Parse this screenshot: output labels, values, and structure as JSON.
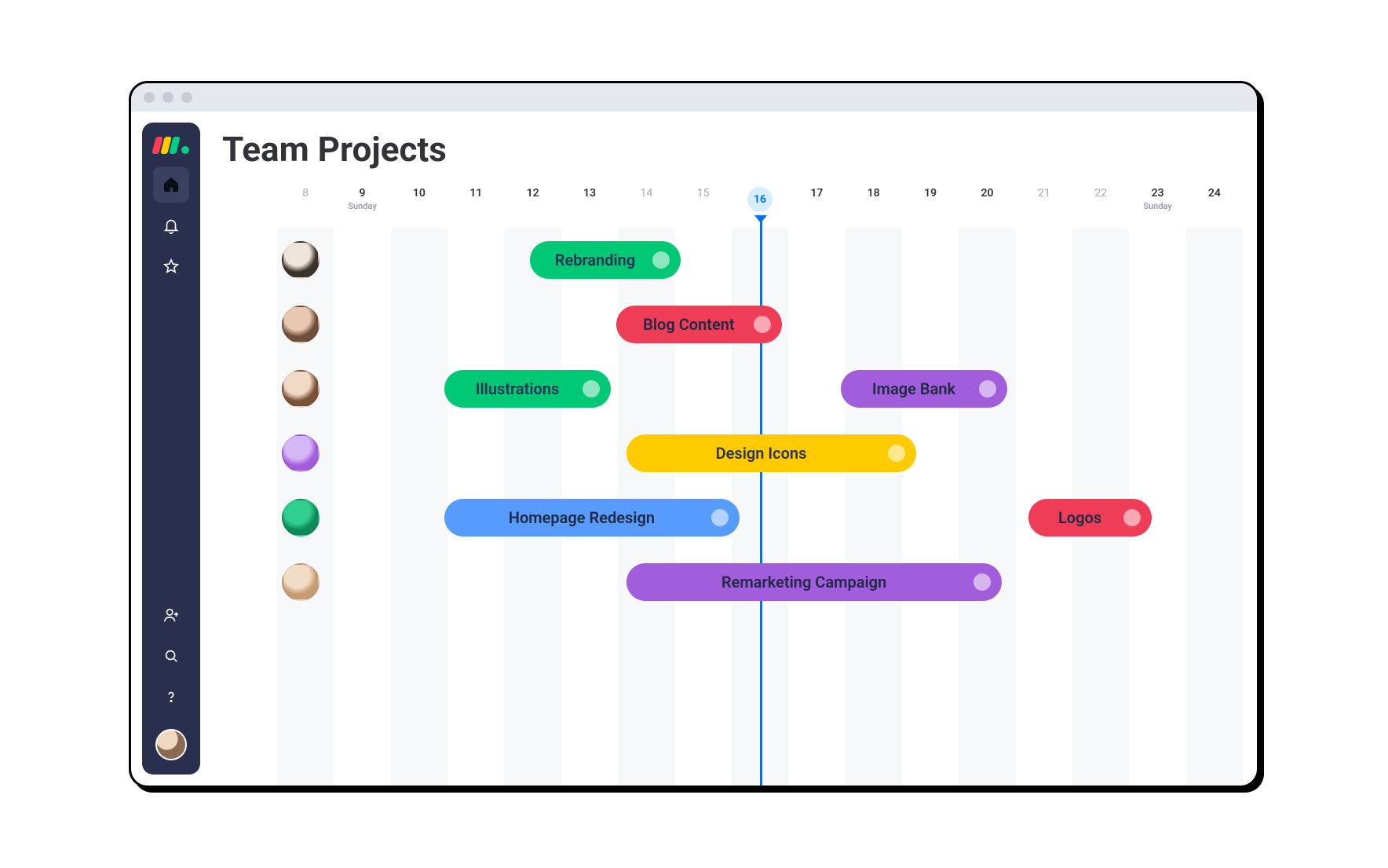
{
  "page_title": "Team Projects",
  "sidebar": {
    "items": [
      {
        "name": "home",
        "icon": "home-icon",
        "active": true
      },
      {
        "name": "notifications",
        "icon": "bell-icon"
      },
      {
        "name": "favorites",
        "icon": "star-icon"
      }
    ],
    "bottom_items": [
      {
        "name": "invite",
        "icon": "add-user-icon"
      },
      {
        "name": "search",
        "icon": "search-icon"
      },
      {
        "name": "help",
        "icon": "help-icon"
      }
    ]
  },
  "timeline": {
    "days": [
      {
        "n": "8"
      },
      {
        "n": "9",
        "sub": "Sunday",
        "strong": true
      },
      {
        "n": "10",
        "strong": true
      },
      {
        "n": "11",
        "strong": true
      },
      {
        "n": "12",
        "strong": true
      },
      {
        "n": "13",
        "strong": true
      },
      {
        "n": "14"
      },
      {
        "n": "15"
      },
      {
        "n": "16",
        "current": true
      },
      {
        "n": "17",
        "strong": true
      },
      {
        "n": "18",
        "strong": true
      },
      {
        "n": "19",
        "strong": true
      },
      {
        "n": "20",
        "strong": true
      },
      {
        "n": "21"
      },
      {
        "n": "22"
      },
      {
        "n": "23",
        "sub": "Sunday",
        "strong": true
      },
      {
        "n": "24",
        "strong": true
      }
    ],
    "day_count": 17,
    "current_index": 8,
    "indicator_visible": true
  },
  "avatars": [
    {
      "name": "member-1",
      "bg": "radial-gradient(circle at 40% 30%, #efe4d9 0 40%, #3a332c 60% 100%)"
    },
    {
      "name": "member-2",
      "bg": "radial-gradient(circle at 40% 30%, #e8c8b0 0 40%, #6e4d3a 60% 100%)"
    },
    {
      "name": "member-3",
      "bg": "radial-gradient(circle at 40% 30%, #f2d9c6 0 40%, #7a5236 60% 100%)"
    },
    {
      "name": "member-4",
      "bg": "radial-gradient(circle at 40% 30%, #d6b7f5 0 40%, #a25ddc 60% 100%)"
    },
    {
      "name": "member-5",
      "bg": "radial-gradient(circle at 40% 30%, #2ecf8f 0 40%, #0f8a5a 60% 100%)"
    },
    {
      "name": "member-6",
      "bg": "radial-gradient(circle at 40% 30%, #f1dcc6 0 40%, #c59b72 60% 100%)"
    }
  ],
  "rows": [
    {
      "bars": [
        {
          "label": "Rebranding",
          "color": "green",
          "start": 3.7,
          "span": 2.8
        }
      ]
    },
    {
      "bars": [
        {
          "label": "Blog Content",
          "color": "red",
          "start": 5.3,
          "span": 3.1
        }
      ]
    },
    {
      "bars": [
        {
          "label": "Illustrations",
          "color": "green",
          "start": 2.1,
          "span": 3.1
        },
        {
          "label": "Image Bank",
          "color": "purple",
          "start": 9.5,
          "span": 3.1
        }
      ]
    },
    {
      "bars": [
        {
          "label": "Design Icons",
          "color": "yellow",
          "start": 5.5,
          "span": 5.4
        }
      ]
    },
    {
      "bars": [
        {
          "label": "Homepage Redesign",
          "color": "blue",
          "start": 2.1,
          "span": 5.5
        },
        {
          "label": "Logos",
          "color": "red",
          "start": 13.0,
          "span": 2.3
        }
      ]
    },
    {
      "bars": [
        {
          "label": "Remarketing Campaign",
          "color": "purple",
          "start": 5.5,
          "span": 7.0
        }
      ]
    }
  ],
  "chart_data": {
    "type": "gantt",
    "title": "Team Projects",
    "x_axis": {
      "unit": "day",
      "start": 8,
      "end": 24,
      "current": 16,
      "weekend_days": [
        14,
        15,
        21,
        22
      ],
      "sunday_labels": [
        9,
        23
      ]
    },
    "series": [
      {
        "assignee": "member-1",
        "task": "Rebranding",
        "start": 12,
        "end": 14,
        "color": "#00c875"
      },
      {
        "assignee": "member-2",
        "task": "Blog Content",
        "start": 13,
        "end": 16,
        "color": "#ef3d57"
      },
      {
        "assignee": "member-3",
        "task": "Illustrations",
        "start": 10,
        "end": 13,
        "color": "#00c875"
      },
      {
        "assignee": "member-3",
        "task": "Image Bank",
        "start": 18,
        "end": 20,
        "color": "#a25ddc"
      },
      {
        "assignee": "member-4",
        "task": "Design Icons",
        "start": 14,
        "end": 19,
        "color": "#ffcb00"
      },
      {
        "assignee": "member-5",
        "task": "Homepage Redesign",
        "start": 10,
        "end": 16,
        "color": "#579bfc"
      },
      {
        "assignee": "member-5",
        "task": "Logos",
        "start": 21,
        "end": 23,
        "color": "#ef3d57"
      },
      {
        "assignee": "member-6",
        "task": "Remarketing Campaign",
        "start": 14,
        "end": 20,
        "color": "#a25ddc"
      }
    ]
  }
}
